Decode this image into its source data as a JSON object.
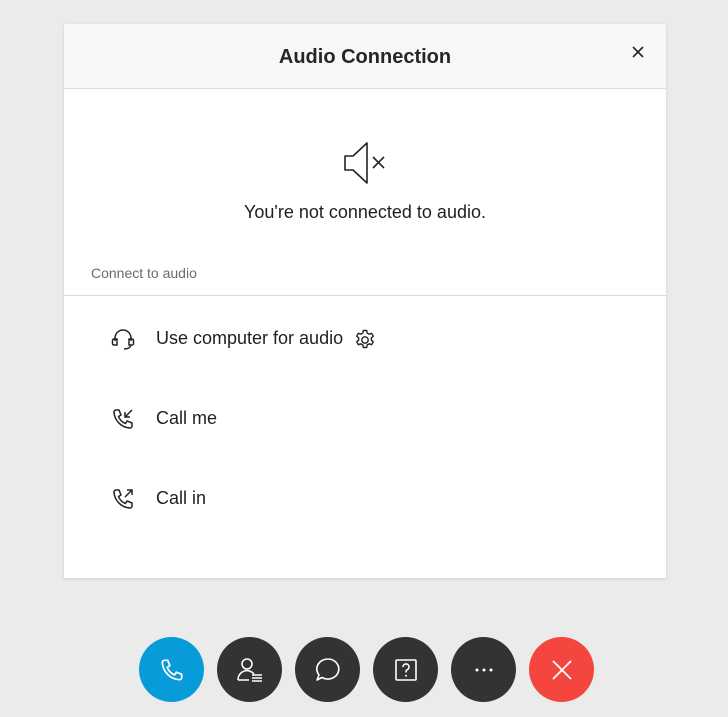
{
  "dialog": {
    "title": "Audio Connection",
    "close_icon": "close-icon"
  },
  "status": {
    "icon": "speaker-muted-icon",
    "message": "You're not connected to audio."
  },
  "section_label": "Connect to audio",
  "options": [
    {
      "label": "Use computer for audio",
      "icon": "headset-icon",
      "has_settings": true
    },
    {
      "label": "Call me",
      "icon": "phone-incoming-icon"
    },
    {
      "label": "Call in",
      "icon": "phone-outgoing-icon"
    }
  ],
  "toolbar": {
    "buttons": [
      {
        "icon": "phone-icon",
        "color": "#079cd9"
      },
      {
        "icon": "participants-icon",
        "color": "#333333"
      },
      {
        "icon": "chat-icon",
        "color": "#333333"
      },
      {
        "icon": "help-icon",
        "color": "#333333"
      },
      {
        "icon": "more-icon",
        "color": "#333333"
      },
      {
        "icon": "end-call-icon",
        "color": "#f4463f"
      }
    ]
  },
  "colors": {
    "background": "#ebebeb",
    "header_bg": "#f7f7f7",
    "accent_blue": "#079cd9",
    "danger_red": "#f4463f",
    "dark_button": "#333333"
  }
}
